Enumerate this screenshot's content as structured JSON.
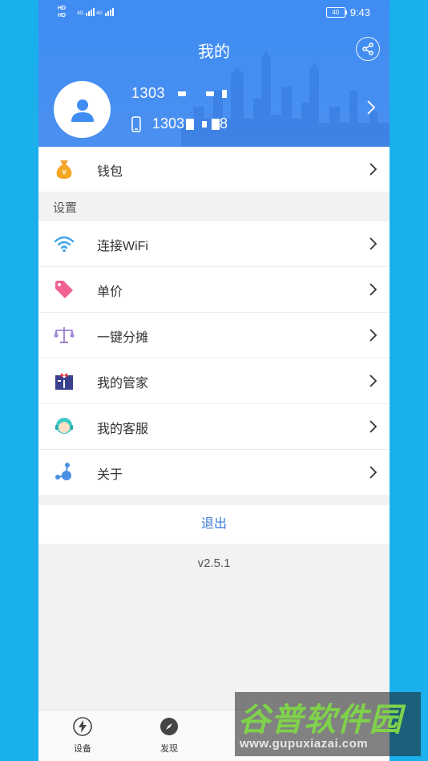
{
  "statusbar": {
    "left_top": "HD",
    "left_bottom": "HD",
    "network1": "4G",
    "network2": "4G",
    "battery": "40",
    "time": "9:43"
  },
  "header": {
    "title": "我的",
    "user_name": "1303",
    "phone_number": "1303",
    "phone_suffix": "8"
  },
  "wallet": {
    "label": "钱包"
  },
  "settings": {
    "section_label": "设置",
    "items": [
      {
        "label": "连接WiFi",
        "icon": "wifi-icon"
      },
      {
        "label": "单价",
        "icon": "price-tag-icon"
      },
      {
        "label": "一键分摊",
        "icon": "scale-icon"
      },
      {
        "label": "我的管家",
        "icon": "butler-icon"
      },
      {
        "label": "我的客服",
        "icon": "customer-service-icon"
      },
      {
        "label": "关于",
        "icon": "about-icon"
      }
    ]
  },
  "logout_label": "退出",
  "version": "v2.5.1",
  "tabbar": {
    "tabs": [
      {
        "label": "设备",
        "icon": "lightning-icon"
      },
      {
        "label": "发现",
        "icon": "compass-icon"
      }
    ]
  },
  "watermark": {
    "title": "谷普软件园",
    "url": "www.gupuxiazai.com"
  },
  "colors": {
    "background": "#1ab0ec",
    "header": "#4a90f0",
    "accent": "#3a7bd5"
  }
}
